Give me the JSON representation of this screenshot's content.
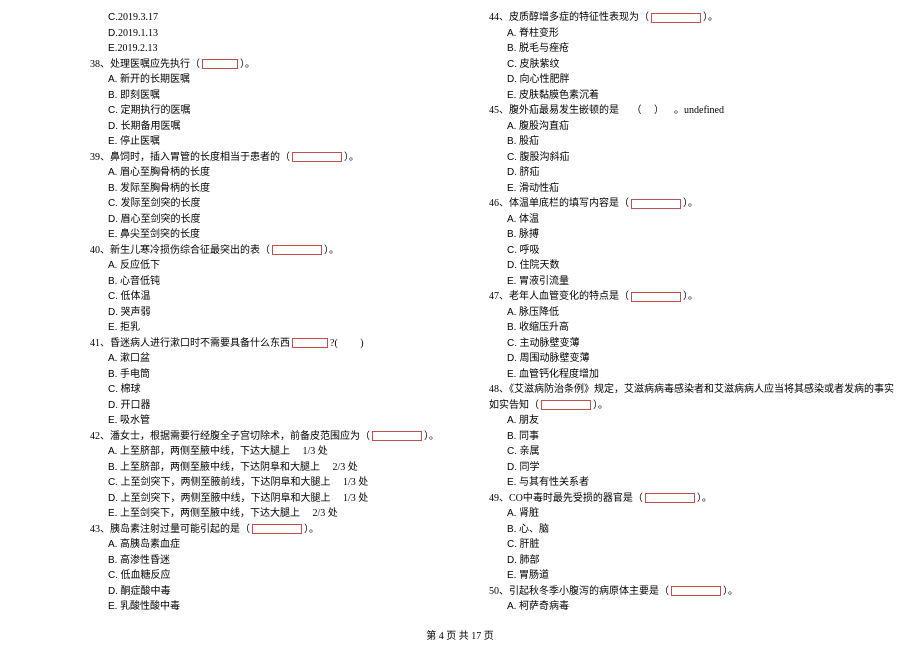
{
  "footer": {
    "text": "第 4 页 共 17 页"
  },
  "left": [
    {
      "t": "opt",
      "letter": "C.",
      "text": "2019.3.17"
    },
    {
      "t": "opt",
      "letter": "D.",
      "text": "2019.1.13"
    },
    {
      "t": "opt",
      "letter": "E.",
      "text": "2019.2.13"
    },
    {
      "t": "q",
      "num": "38、",
      "text_before": "处理医嘱应先执行（",
      "blank": "sm",
      "text_after": "）。"
    },
    {
      "t": "opt",
      "letter": "A.",
      "text": " 新开的长期医嘱"
    },
    {
      "t": "opt",
      "letter": "B.",
      "text": " 即刻医嘱"
    },
    {
      "t": "opt",
      "letter": "C.",
      "text": " 定期执行的医嘱"
    },
    {
      "t": "opt",
      "letter": "D.",
      "text": " 长期备用医嘱"
    },
    {
      "t": "opt",
      "letter": "E.",
      "text": " 停止医嘱"
    },
    {
      "t": "q",
      "num": "39、",
      "text_before": "鼻饲时，插入胃管的长度相当于患者的（",
      "blank": "md",
      "text_after": "）。"
    },
    {
      "t": "opt",
      "letter": "A.",
      "text": " 眉心至胸骨柄的长度"
    },
    {
      "t": "opt",
      "letter": "B.",
      "text": " 发际至胸骨柄的长度"
    },
    {
      "t": "opt",
      "letter": "C.",
      "text": " 发际至剑突的长度"
    },
    {
      "t": "opt",
      "letter": "D.",
      "text": " 眉心至剑突的长度"
    },
    {
      "t": "opt",
      "letter": "E.",
      "text": " 鼻尖至剑突的长度"
    },
    {
      "t": "q",
      "num": "40、",
      "text_before": "新生儿寒冷损伤综合征最突出的表（",
      "blank": "md",
      "text_after": "）。"
    },
    {
      "t": "opt",
      "letter": "A.",
      "text": " 反应低下"
    },
    {
      "t": "opt",
      "letter": "B.",
      "text": " 心音低钝"
    },
    {
      "t": "opt",
      "letter": "C.",
      "text": " 低体温"
    },
    {
      "t": "opt",
      "letter": "D.",
      "text": " 哭声弱"
    },
    {
      "t": "opt",
      "letter": "E.",
      "text": " 拒乳"
    },
    {
      "t": "q",
      "num": "41、",
      "text_before": "昏迷病人进行漱口时不需要具备什么东西",
      "blank": "sm",
      "text_after": "?(         )"
    },
    {
      "t": "opt",
      "letter": "A.",
      "text": " 漱口盆"
    },
    {
      "t": "opt",
      "letter": "B.",
      "text": " 手电筒"
    },
    {
      "t": "opt",
      "letter": "C.",
      "text": " 棉球"
    },
    {
      "t": "opt",
      "letter": "D.",
      "text": " 开口器"
    },
    {
      "t": "opt",
      "letter": "E.",
      "text": " 吸水管"
    },
    {
      "t": "q",
      "num": "42、",
      "text_before": "潘女士，根据需要行经腹全子宫切除术，前备皮范围应为（",
      "blank": "md",
      "text_after": "）。"
    },
    {
      "t": "opt",
      "letter": "A.",
      "text": " 上至脐部，两侧至腋中线，下达大腿上     1/3 处"
    },
    {
      "t": "opt",
      "letter": "B.",
      "text": " 上至脐部，两侧至腋中线，下达阴阜和大腿上     2/3 处"
    },
    {
      "t": "opt",
      "letter": "C.",
      "text": " 上至剑突下，两侧至腋前线，下达阴阜和大腿上     1/3 处"
    },
    {
      "t": "opt",
      "letter": "D.",
      "text": " 上至剑突下，两侧至腋中线，下达阴阜和大腿上     1/3 处"
    },
    {
      "t": "opt",
      "letter": "E.",
      "text": " 上至剑突下，两侧至腋中线，下达大腿上     2/3 处"
    },
    {
      "t": "q",
      "num": "43、",
      "text_before": "胰岛素注射过量可能引起的是（",
      "blank": "md",
      "text_after": "）。"
    },
    {
      "t": "opt",
      "letter": "A.",
      "text": " 高胰岛素血症"
    },
    {
      "t": "opt",
      "letter": "B.",
      "text": " 高渗性昏迷"
    },
    {
      "t": "opt",
      "letter": "C.",
      "text": " 低血糖反应"
    },
    {
      "t": "opt",
      "letter": "D.",
      "text": " 酮症酸中毒"
    },
    {
      "t": "opt",
      "letter": "E.",
      "text": " 乳酸性酸中毒"
    }
  ],
  "right": [
    {
      "t": "q",
      "num": "44、",
      "text_before": "皮质醇增多症的特征性表现为（",
      "blank": "md",
      "text_after": "）。"
    },
    {
      "t": "opt",
      "letter": "A.",
      "text": " 脊柱变形"
    },
    {
      "t": "opt",
      "letter": "B.",
      "text": " 脱毛与痤疮"
    },
    {
      "t": "opt",
      "letter": "C.",
      "text": " 皮肤紫纹"
    },
    {
      "t": "opt",
      "letter": "D.",
      "text": " 向心性肥胖"
    },
    {
      "t": "opt",
      "letter": "E.",
      "text": " 皮肤黏膜色素沉着"
    },
    {
      "t": "q",
      "num": "45、",
      "text_before": "腹外疝最易发生嵌顿的是     （     ）    。"
    },
    {
      "t": "opt",
      "letter": "A.",
      "text": " 腹股沟直疝"
    },
    {
      "t": "opt",
      "letter": "B.",
      "text": " 股疝"
    },
    {
      "t": "opt",
      "letter": "C.",
      "text": " 腹股沟斜疝"
    },
    {
      "t": "opt",
      "letter": "D.",
      "text": " 脐疝"
    },
    {
      "t": "opt",
      "letter": "E.",
      "text": " 滑动性疝"
    },
    {
      "t": "q",
      "num": "46、",
      "text_before": "体温单底栏的填写内容是（",
      "blank": "md",
      "text_after": "）。"
    },
    {
      "t": "opt",
      "letter": "A.",
      "text": " 体温"
    },
    {
      "t": "opt",
      "letter": "B.",
      "text": " 脉搏"
    },
    {
      "t": "opt",
      "letter": "C.",
      "text": " 呼吸"
    },
    {
      "t": "opt",
      "letter": "D.",
      "text": " 住院天数"
    },
    {
      "t": "opt",
      "letter": "E.",
      "text": " 胃液引流量"
    },
    {
      "t": "q",
      "num": "47、",
      "text_before": "老年人血管变化的特点是（",
      "blank": "md",
      "text_after": "）。"
    },
    {
      "t": "opt",
      "letter": "A.",
      "text": " 脉压降低"
    },
    {
      "t": "opt",
      "letter": "B.",
      "text": " 收缩压升高"
    },
    {
      "t": "opt",
      "letter": "C.",
      "text": " 主动脉壁变薄"
    },
    {
      "t": "opt",
      "letter": "D.",
      "text": " 周围动脉壁变薄"
    },
    {
      "t": "opt",
      "letter": "E.",
      "text": " 血管钙化程度增加"
    },
    {
      "t": "q",
      "num": "48、",
      "text_plain": "《艾滋病防治条例》规定，艾滋病病毒感染者和艾滋病病人应当将其感染或者发病的事实"
    },
    {
      "t": "cont",
      "text_before": "如实告知（",
      "blank": "md",
      "text_after": "）。"
    },
    {
      "t": "opt",
      "letter": "A.",
      "text": " 朋友"
    },
    {
      "t": "opt",
      "letter": "B.",
      "text": " 同事"
    },
    {
      "t": "opt",
      "letter": "C.",
      "text": " 亲属"
    },
    {
      "t": "opt",
      "letter": "D.",
      "text": " 同学"
    },
    {
      "t": "opt",
      "letter": "E.",
      "text": " 与其有性关系者"
    },
    {
      "t": "q",
      "num": "49、",
      "text_before": "CO中毒时最先受损的器官是（",
      "blank": "md",
      "text_after": "）。"
    },
    {
      "t": "opt",
      "letter": "A.",
      "text": " 肾脏"
    },
    {
      "t": "opt",
      "letter": "B.",
      "text": " 心、脑"
    },
    {
      "t": "opt",
      "letter": "C.",
      "text": " 肝脏"
    },
    {
      "t": "opt",
      "letter": "D.",
      "text": " 肺部"
    },
    {
      "t": "opt",
      "letter": "E.",
      "text": " 胃肠道"
    },
    {
      "t": "q",
      "num": "50、",
      "text_before": "引起秋冬季小腹泻的病原体主要是（",
      "blank": "md",
      "text_after": "）。"
    },
    {
      "t": "opt",
      "letter": "A.",
      "text": " 柯萨奇病毒"
    }
  ]
}
